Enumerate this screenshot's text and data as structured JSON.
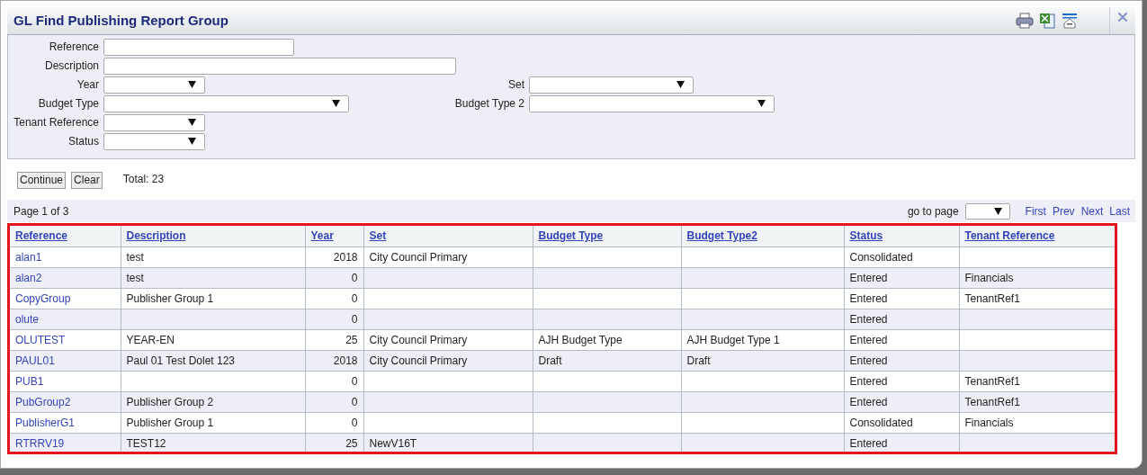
{
  "window": {
    "title": "GL Find Publishing Report Group"
  },
  "filter_rows": [
    [
      {
        "label": "Reference",
        "kind": "text"
      }
    ],
    [
      {
        "label": "Description",
        "kind": "text"
      }
    ],
    [
      {
        "label": "Year",
        "kind": "select"
      },
      {
        "label": "Set",
        "kind": "select"
      }
    ],
    [
      {
        "label": "Budget Type",
        "kind": "select"
      },
      {
        "label": "Budget Type 2",
        "kind": "select"
      }
    ],
    [
      {
        "label": "Tenant Reference",
        "kind": "select"
      }
    ],
    [
      {
        "label": "Status",
        "kind": "select"
      }
    ]
  ],
  "buttons": [
    "Continue",
    "Clear"
  ],
  "total": "Total: 23",
  "pager": {
    "page_info": "Page 1 of 3",
    "goto_label": "go to page",
    "links": [
      "First",
      "Prev",
      "Next",
      "Last"
    ]
  },
  "table": {
    "columns": [
      "Reference",
      "Description",
      "Year",
      "Set",
      "Budget Type",
      "Budget Type2",
      "Status",
      "Tenant Reference"
    ],
    "rows": [
      [
        "alan1",
        "test",
        "2018",
        "City Council Primary",
        "",
        "",
        "Consolidated",
        ""
      ],
      [
        "alan2",
        "test",
        "0",
        "",
        "",
        "",
        "Entered",
        "Financials"
      ],
      [
        "CopyGroup",
        "Publisher Group 1",
        "0",
        "",
        "",
        "",
        "Entered",
        "TenantRef1"
      ],
      [
        "olute",
        "",
        "0",
        "",
        "",
        "",
        "Entered",
        ""
      ],
      [
        "OLUTEST",
        "YEAR-EN",
        "25",
        "City Council Primary",
        "AJH Budget Type",
        "AJH Budget Type 1",
        "Entered",
        ""
      ],
      [
        "PAUL01",
        "Paul 01 Test Dolet 123",
        "2018",
        "City Council Primary",
        "Draft",
        "Draft",
        "Entered",
        ""
      ],
      [
        "PUB1",
        "",
        "0",
        "",
        "",
        "",
        "Entered",
        "TenantRef1"
      ],
      [
        "PubGroup2",
        "Publisher Group 2",
        "0",
        "",
        "",
        "",
        "Entered",
        "TenantRef1"
      ],
      [
        "PublisherG1",
        "Publisher Group 1",
        "0",
        "",
        "",
        "",
        "Consolidated",
        "Financials"
      ],
      [
        "RTRRV19",
        "TEST12",
        "25",
        "NewV16T",
        "",
        "",
        "Entered",
        ""
      ]
    ]
  }
}
